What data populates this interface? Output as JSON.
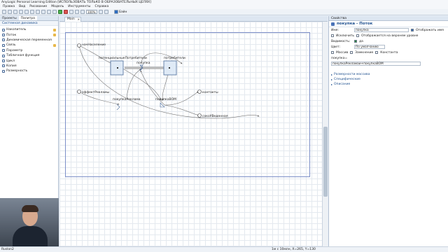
{
  "window": {
    "title": "AnyLogic Personal Learning Edition [ИСПОЛЬЗОВАТЬ ТОЛЬКО В ОБРАЗОВАТЕЛЬНЫХ ЦЕЛЯХ]"
  },
  "menu": [
    "Правка",
    "Вид",
    "Рисование",
    "Модель",
    "Инструменты",
    "Справка"
  ],
  "toolbar": {
    "zoom": "100%",
    "build_label": "Бэйн"
  },
  "left_pane": {
    "tabs": [
      "Проекты",
      "Палитра"
    ],
    "section": "Системная динамика",
    "items": [
      {
        "label": "Накопитель",
        "icon": "stock-icon"
      },
      {
        "label": "Поток",
        "icon": "flow-icon"
      },
      {
        "label": "Динамическая переменная",
        "icon": "dynamic-variable-icon"
      },
      {
        "label": "Связь",
        "icon": "link-icon"
      },
      {
        "label": "Параметр",
        "icon": "parameter-icon"
      },
      {
        "label": "Табличная функция",
        "icon": "table-function-icon"
      },
      {
        "label": "Цикл",
        "icon": "loop-icon"
      },
      {
        "label": "Копия",
        "icon": "shadow-icon"
      },
      {
        "label": "Размерность",
        "icon": "dimension-icon"
      }
    ]
  },
  "editor": {
    "tab": "Main"
  },
  "diagram": {
    "stocks": [
      "потенциальныеПотребители",
      "потребители"
    ],
    "flows": [
      "покупка",
      "покупкаРеклама",
      "покупкаВОМ"
    ],
    "params": [
      "начНаселение",
      "эффектРекламы",
      "контакты",
      "сокоУВеденная"
    ]
  },
  "properties": {
    "tab": "Свойства",
    "title": "покупка - Поток",
    "name_label": "Имя:",
    "name_value": "покупка",
    "show_name": "Отображать имя",
    "exclude": "Исключить",
    "show_upper": "Отображается на верхнем уровне",
    "visibility_label": "Видимость:",
    "visibility_value": "да",
    "color_label": "Цвет:",
    "color_value": "По умолчанию",
    "array": "Массив",
    "delay": "Замкнение",
    "constant": "Константа",
    "formula_label": "покупка=",
    "formula_value": "покупкаРекламаи+покупкаВОМ",
    "sections": [
      "Размерности массива",
      "Специфические",
      "Описание"
    ]
  },
  "status": {
    "left": "Ruslon2",
    "right": "1м с 10млн, X=265, Y=130"
  },
  "colors": {
    "accent": "#1e4f8e",
    "frame": "#7d8fc8"
  }
}
